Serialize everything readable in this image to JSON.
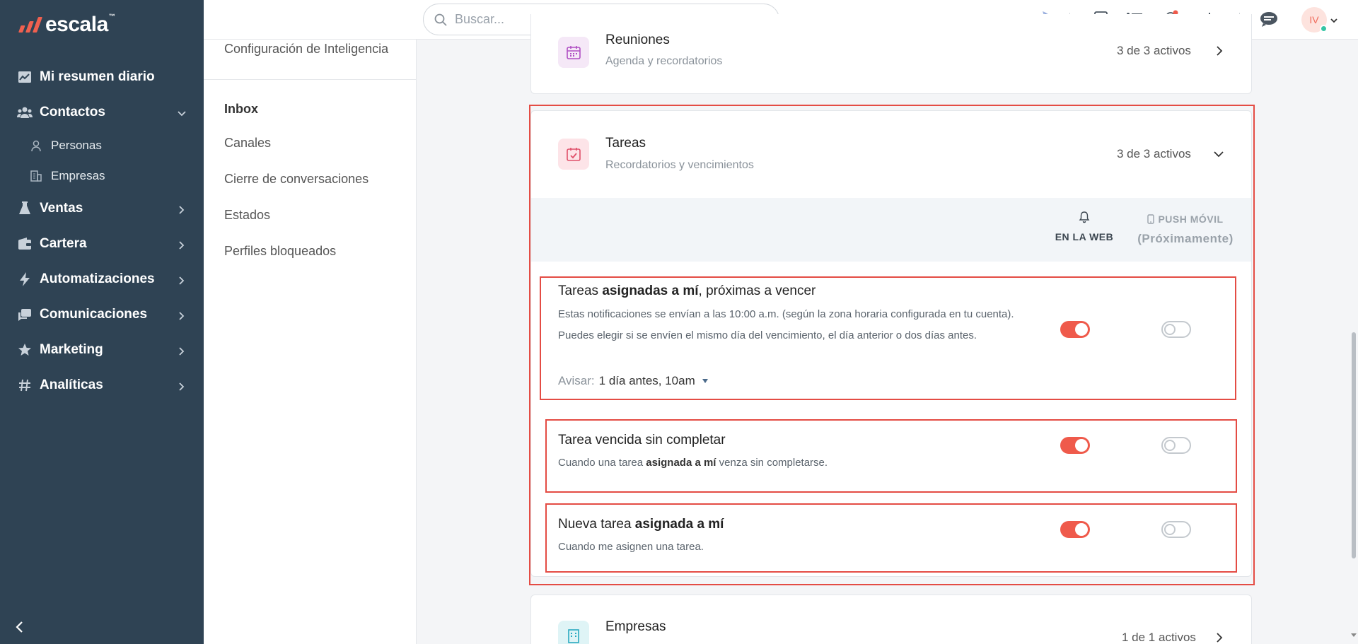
{
  "app": {
    "brand": "escala",
    "brand_tm": "™"
  },
  "sidebar": {
    "items": [
      {
        "label": "Mi resumen diario",
        "icon": "chart-line-icon"
      },
      {
        "label": "Contactos",
        "icon": "users-icon",
        "expanded": true
      },
      {
        "label": "Personas",
        "icon": "user-icon",
        "sub": true
      },
      {
        "label": "Empresas",
        "icon": "building-icon",
        "sub": true
      },
      {
        "label": "Ventas",
        "icon": "flask-icon"
      },
      {
        "label": "Cartera",
        "icon": "wallet-icon"
      },
      {
        "label": "Automatizaciones",
        "icon": "bolt-icon"
      },
      {
        "label": "Comunicaciones",
        "icon": "chat-icon"
      },
      {
        "label": "Marketing",
        "icon": "star-icon"
      },
      {
        "label": "Analíticas",
        "icon": "hash-icon"
      }
    ]
  },
  "subnav": {
    "top_item": "Configuración de Inteligencia",
    "heading": "Inbox",
    "items": [
      "Canales",
      "Cierre de conversaciones",
      "Estados",
      "Perfiles bloqueados"
    ]
  },
  "topbar": {
    "search_placeholder": "Buscar...",
    "avatar_initials": "IV"
  },
  "categories": {
    "reuniones": {
      "title": "Reuniones",
      "desc": "Agenda y recordatorios",
      "count": "3 de 3 activos"
    },
    "tareas": {
      "title": "Tareas",
      "desc": "Recordatorios y vencimientos",
      "count": "3 de 3 activos"
    },
    "empresas": {
      "title": "Empresas",
      "count": "1 de 1 activos"
    }
  },
  "columns": {
    "web": "EN LA WEB",
    "push": "PUSH MÓVIL",
    "push_note": "(Próximamente)"
  },
  "rows": [
    {
      "title_pre": "Tareas ",
      "title_bold": "asignadas a mí",
      "title_post": ", próximas a vencer",
      "desc": "Estas notificaciones se envían a las 10:00 a.m. (según la zona horaria configurada en tu cuenta). Puedes elegir si se envíen el mismo día del vencimiento, el día anterior o dos días antes.",
      "avisar_label": "Avisar:",
      "avisar_value": "1 día antes, 10am",
      "web": true,
      "push": false
    },
    {
      "title": "Tarea vencida sin completar",
      "desc_pre": "Cuando una tarea ",
      "desc_bold": "asignada a mí",
      "desc_post": " venza sin completarse.",
      "web": true,
      "push": false
    },
    {
      "title_pre": "Nueva tarea ",
      "title_bold": "asignada a mí",
      "desc": "Cuando me asignen una tarea.",
      "web": true,
      "push": false
    }
  ],
  "colors": {
    "sidebar": "#2f4354",
    "accent": "#ef5a4b",
    "highlight": "#e44c44"
  }
}
